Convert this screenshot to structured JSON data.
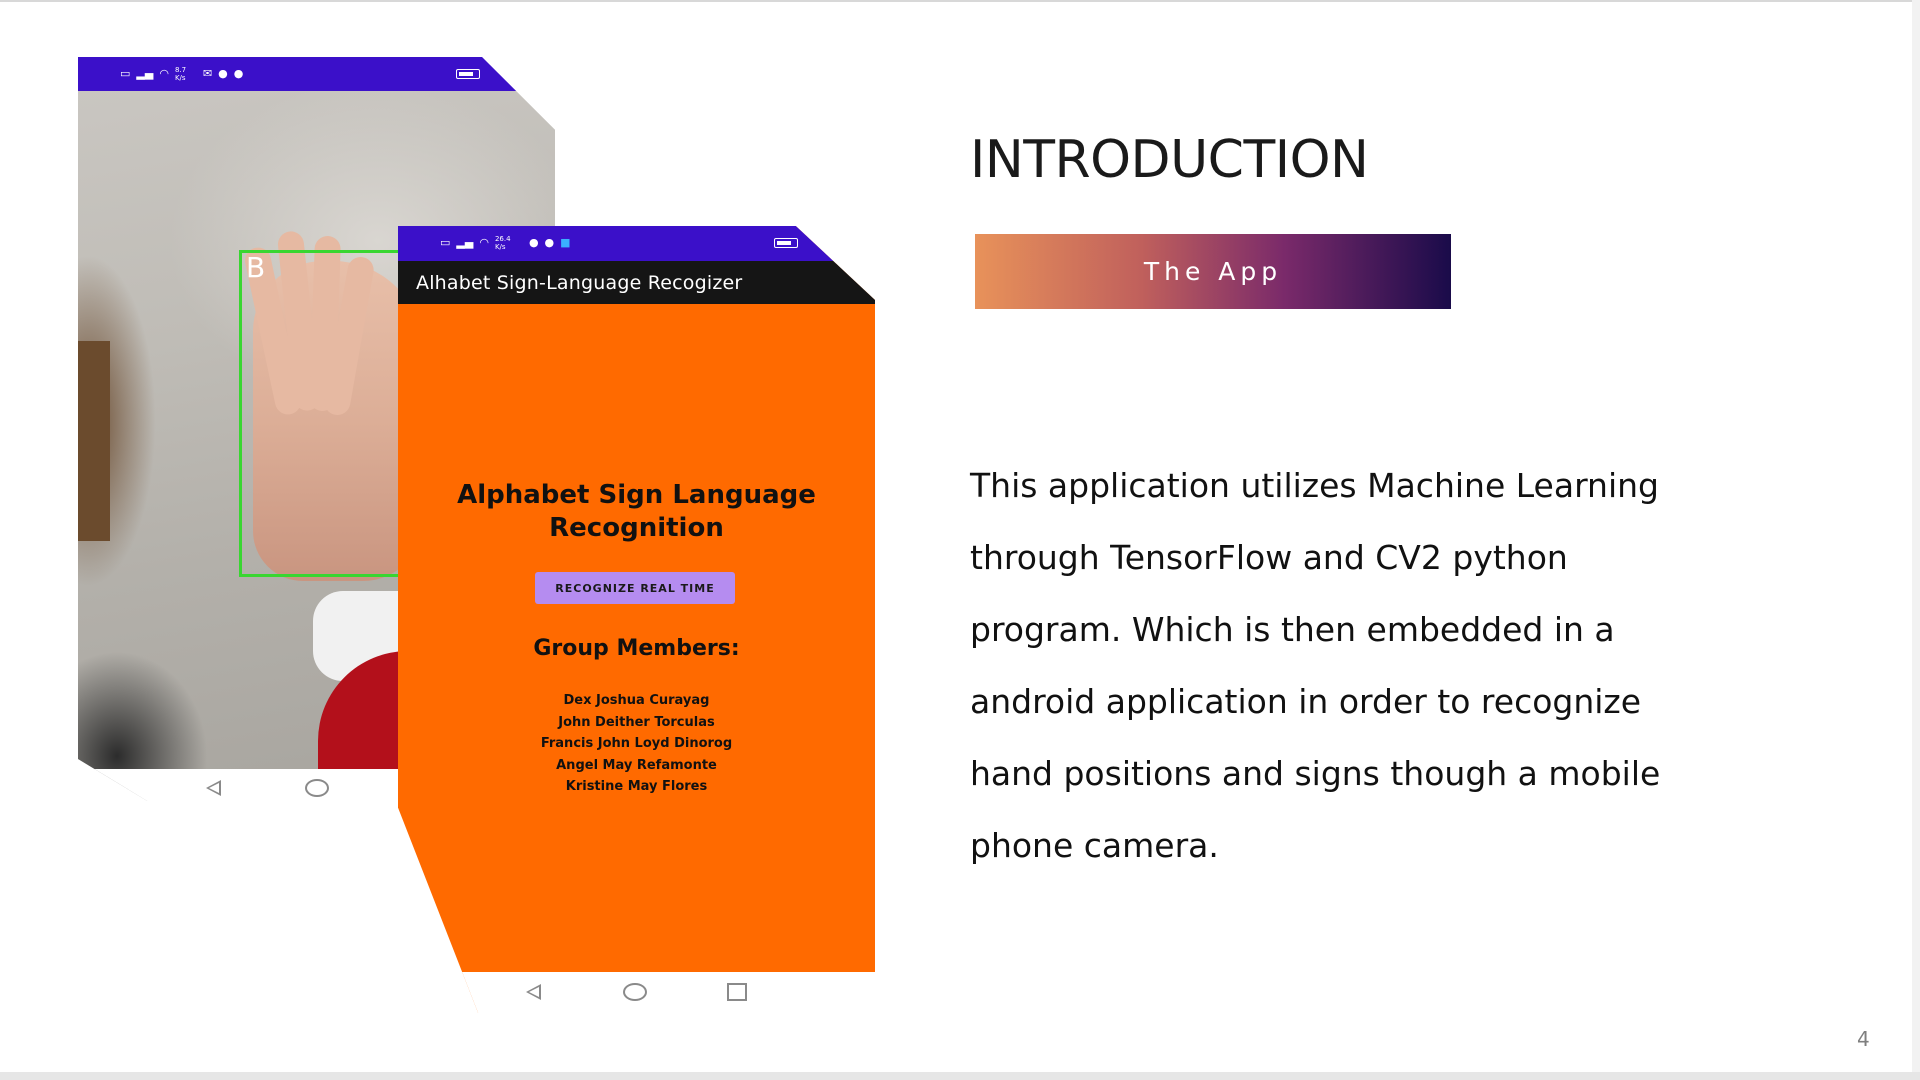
{
  "slide": {
    "title": "INTRODUCTION",
    "subtitle": "The App",
    "body": "This application utilizes Machine Learning\nthrough TensorFlow and CV2 python\nprogram. Which is then embedded in a\nandroid application in order to recognize\nhand positions and signs though a mobile\nphone camera.",
    "page_number": "4",
    "subtitle_gradient": [
      "#e8925a",
      "#c0605c",
      "#7a2a6a",
      "#1a0b4a"
    ]
  },
  "camera_phone": {
    "status_bar": {
      "network_speed": "8.7 K/s",
      "battery": "57"
    },
    "detected_letter": "B",
    "detection_color": "#39d631"
  },
  "app_phone": {
    "status_bar": {
      "network_speed": "26.4 K/s",
      "battery": "57"
    },
    "app_title": "Alhabet Sign-Language Recogizer",
    "heading_line1": "Alphabet Sign Language",
    "heading_line2": "Recognition",
    "button_label": "RECOGNIZE REAL TIME",
    "members_heading": "Group Members:",
    "members": [
      "Dex Joshua Curayag",
      "John Deither Torculas",
      "Francis John Loyd Dinorog",
      "Angel May Refamonte",
      "Kristine May Flores"
    ],
    "background_color": "#ff6a00",
    "status_color": "#3b10c9",
    "button_color": "#b58cf0"
  },
  "icons": {
    "status": [
      "wifi-label-icon",
      "signal-icon",
      "wifi-icon",
      "mail-icon",
      "facebook-icon",
      "messenger-icon",
      "battery-icon"
    ],
    "nav": [
      "nav-back-icon",
      "nav-home-icon",
      "nav-recent-icon"
    ]
  }
}
